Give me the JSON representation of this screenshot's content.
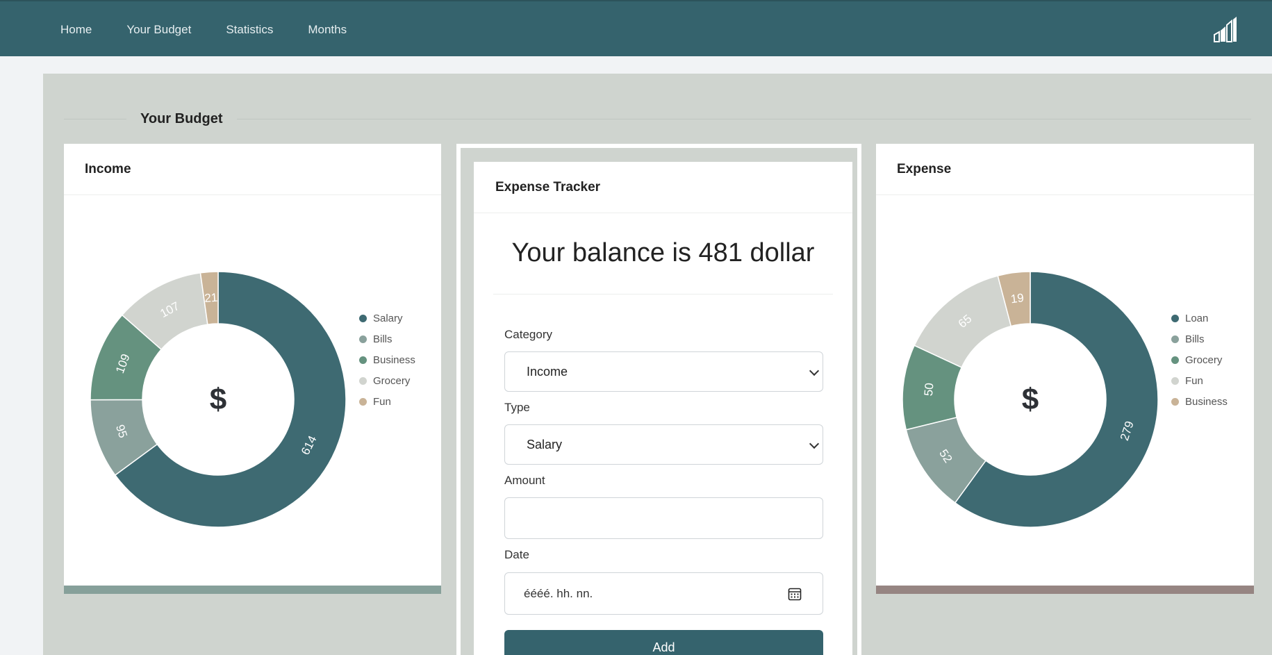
{
  "nav": {
    "items": [
      {
        "label": "Home"
      },
      {
        "label": "Your Budget"
      },
      {
        "label": "Statistics"
      },
      {
        "label": "Months"
      }
    ],
    "logo_icon": "bar-chart-logo-icon"
  },
  "section": {
    "title": "Your Budget"
  },
  "income": {
    "title": "Income",
    "center_symbol": "$",
    "footer_color": "#86a09a"
  },
  "expense": {
    "title": "Expense",
    "center_symbol": "$",
    "footer_color": "#968582"
  },
  "tracker": {
    "title": "Expense Tracker",
    "balance_text": "Your balance is 481 dollar",
    "category_label": "Category",
    "category_value": "Income",
    "type_label": "Type",
    "type_value": "Salary",
    "amount_label": "Amount",
    "amount_value": "",
    "date_label": "Date",
    "date_placeholder": "éééé. hh. nn.",
    "add_label": "Add"
  },
  "colors": {
    "nav": "#35636d",
    "slice_dark": "#3e6a72",
    "slice_gray": "#8aa19c",
    "slice_green": "#65927f",
    "slice_light": "#d1d4cf",
    "slice_tan": "#c9b397"
  },
  "chart_data": [
    {
      "type": "pie",
      "categories": [
        "Salary",
        "Bills",
        "Business",
        "Grocery",
        "Fun"
      ],
      "values": [
        614,
        95,
        109,
        107,
        21
      ],
      "colors": [
        "#3e6a72",
        "#8aa19c",
        "#65927f",
        "#d1d4cf",
        "#c9b397"
      ],
      "legend": "right",
      "title": "Income"
    },
    {
      "type": "pie",
      "categories": [
        "Loan",
        "Bills",
        "Grocery",
        "Fun",
        "Business"
      ],
      "values": [
        279,
        52,
        50,
        65,
        19
      ],
      "colors": [
        "#3e6a72",
        "#8aa19c",
        "#65927f",
        "#d1d4cf",
        "#c9b397"
      ],
      "legend": "right",
      "title": "Expense"
    }
  ]
}
